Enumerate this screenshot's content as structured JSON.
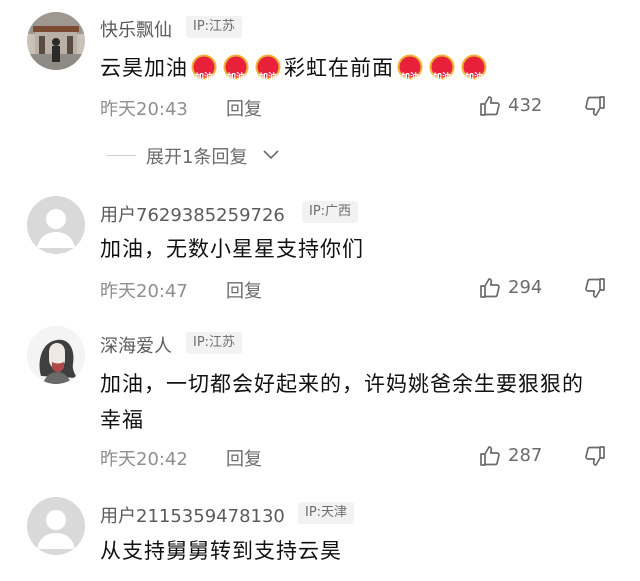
{
  "comments": [
    {
      "username": "快乐飘仙",
      "ip": "IP:江苏",
      "content_parts": [
        "云昊加油",
        "彩虹在前面"
      ],
      "emoji_label": "加油",
      "time": "昨天20:43",
      "reply_label": "回复",
      "likes": "432",
      "expand_label": "展开1条回复"
    },
    {
      "username": "用户7629385259726",
      "ip": "IP:广西",
      "content": "加油，无数小星星支持你们",
      "time": "昨天20:47",
      "reply_label": "回复",
      "likes": "294"
    },
    {
      "username": "深海爱人",
      "ip": "IP:江苏",
      "content": "加油，一切都会好起来的，许妈姚爸余生要狠狠的幸福",
      "time": "昨天20:42",
      "reply_label": "回复",
      "likes": "287"
    },
    {
      "username": "用户2115359478130",
      "ip": "IP:天津",
      "content": "从支持舅舅转到支持云昊"
    }
  ],
  "colors": {
    "emoji_red": "#e8203a",
    "emoji_gold": "#f0b236",
    "icon_grey": "#6b6b6b"
  },
  "icons": [
    "like-icon",
    "dislike-icon",
    "chevron-down-icon",
    "default-avatar-icon"
  ]
}
